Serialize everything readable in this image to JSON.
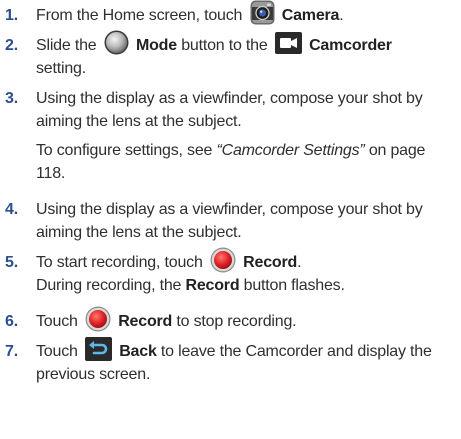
{
  "steps": [
    {
      "number": "1.",
      "before": "From the Home screen, touch",
      "icon": "camera-app-icon",
      "bold": "Camera",
      "after": "."
    },
    {
      "number": "2.",
      "before": "Slide the",
      "icon1": "mode-toggle-icon",
      "bold1": "Mode",
      "middle": "button to the",
      "icon2": "camcorder-icon",
      "bold2": "Camcorder",
      "after": "setting."
    },
    {
      "number": "3.",
      "text": "Using the display as a viewfinder, compose your shot by aiming the lens at the subject.",
      "sub_before": "To configure settings, see",
      "sub_italic": "“Camcorder Settings”",
      "sub_after": "on page 118."
    },
    {
      "number": "4.",
      "text": "Using the display as a viewfinder, compose your shot by aiming the lens at the subject."
    },
    {
      "number": "5.",
      "before": "To start recording, touch",
      "icon": "record-button-icon",
      "bold": "Record",
      "after": ".",
      "sub_before": "During recording, the",
      "sub_bold": "Record",
      "sub_after": "button flashes."
    },
    {
      "number": "6.",
      "before": "Touch",
      "icon": "record-button-icon",
      "bold": "Record",
      "after": "to stop recording."
    },
    {
      "number": "7.",
      "before": "Touch",
      "icon": "back-arrow-icon",
      "bold": "Back",
      "after": "to leave the Camcorder and display the previous screen."
    }
  ],
  "colors": {
    "step_number": "#2b4f8f",
    "record": "#e1252b",
    "icon_dark": "#2a2a2a"
  }
}
